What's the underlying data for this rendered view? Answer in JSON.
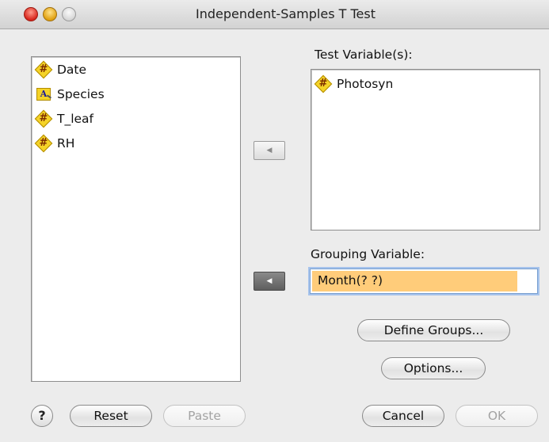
{
  "window": {
    "title": "Independent-Samples T Test"
  },
  "source_variables": [
    {
      "name": "Date",
      "type": "numeric",
      "icon": "numeric-variable-icon"
    },
    {
      "name": "Species",
      "type": "string",
      "icon": "string-variable-icon"
    },
    {
      "name": "T_leaf",
      "type": "numeric",
      "icon": "numeric-variable-icon"
    },
    {
      "name": "RH",
      "type": "numeric",
      "icon": "numeric-variable-icon"
    }
  ],
  "test_variables": {
    "label": "Test Variable(s):",
    "items": [
      {
        "name": "Photosyn",
        "type": "numeric",
        "icon": "numeric-variable-icon"
      }
    ]
  },
  "grouping": {
    "label": "Grouping Variable:",
    "value": "Month(? ?)"
  },
  "buttons": {
    "define_groups": "Define Groups...",
    "options": "Options...",
    "help": "?",
    "reset": "Reset",
    "paste": "Paste",
    "cancel": "Cancel",
    "ok": "OK"
  },
  "icons": {
    "numeric": "#",
    "string": "A"
  },
  "colors": {
    "variable_icon": "#f5d327",
    "grouping_highlight": "#ffcc7a"
  }
}
